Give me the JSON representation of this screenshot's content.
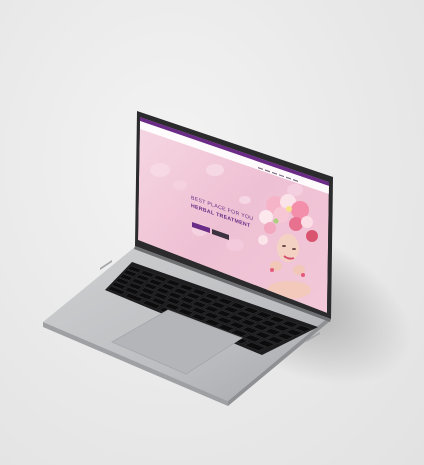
{
  "scene": {
    "background_color": "#e9e9e9",
    "device": "laptop",
    "accent_color": "#6a2c86"
  },
  "website": {
    "logo_letter": "A",
    "headline_line1": "BEST PLACE FOR YOU",
    "headline_line2": "HERBAL TREATMENT",
    "nav_items": [
      "",
      "",
      "",
      "",
      "",
      ""
    ],
    "primary_button": "",
    "secondary_button": "",
    "hero_theme": "pink-floral"
  },
  "keyboard": {
    "rows": [
      14,
      14,
      14,
      13,
      12,
      9
    ]
  }
}
